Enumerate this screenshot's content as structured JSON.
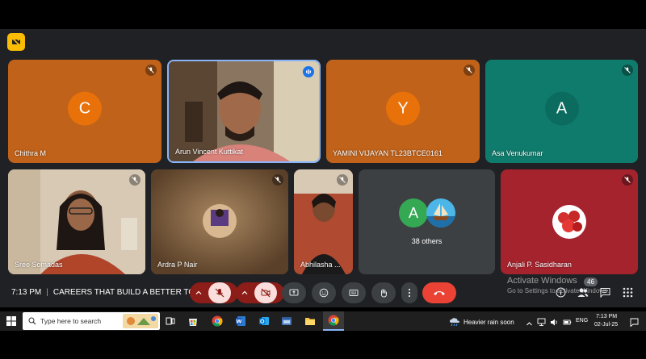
{
  "meeting": {
    "time": "7:13 PM",
    "title": "CAREERS THAT BUILD A BETTER TO...",
    "others_label": "38 others",
    "count_badge": "46"
  },
  "tiles": [
    {
      "name": "Chithra M",
      "initial": "C",
      "bg": "#c0621a",
      "avatar": "#e8710a"
    },
    {
      "name": "Arun Vincent Kuttikat"
    },
    {
      "name": "YAMINI VIJAYAN TL23BTCE0161",
      "initial": "Y",
      "bg": "#c0621a",
      "avatar": "#e8710a"
    },
    {
      "name": "Asa Venukumar",
      "initial": "A",
      "bg": "#0f7b6c",
      "avatar": "#0b6b5e"
    },
    {
      "name": "Sree Somadas"
    },
    {
      "name": "Ardra P Nair"
    },
    {
      "name": "Abhilasha ..."
    },
    {
      "name": "",
      "initial": "A"
    },
    {
      "name": "Anjali P. Sasidharan"
    }
  ],
  "watermark": {
    "line1": "Activate Windows",
    "line2": "Go to Settings to activate Windows."
  },
  "taskbar": {
    "search_placeholder": "Type here to search",
    "weather": "Heavier rain soon",
    "lang": "ENG",
    "clock_time": "7:13 PM",
    "clock_date": "02-Jul-25"
  },
  "colors": {
    "meet_bg": "#202124",
    "hangup": "#ea4335",
    "muted_btn": "#f9dedc",
    "orange_tile": "#c0621a",
    "teal_tile": "#0f7b6c"
  }
}
